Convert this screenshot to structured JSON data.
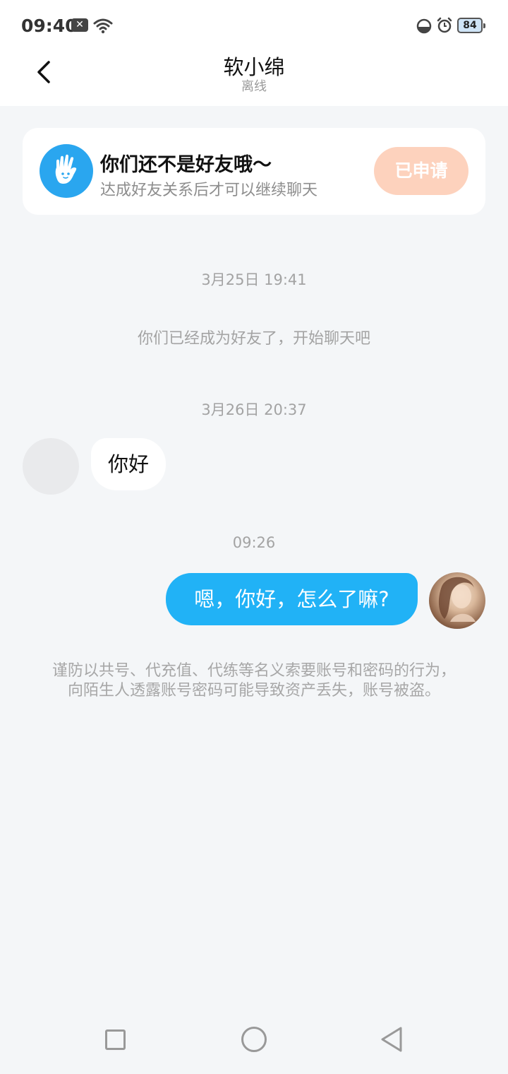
{
  "status_bar": {
    "time": "09:40",
    "notification_icon": "x-badge-icon",
    "battery": "84"
  },
  "header": {
    "title": "软小绵",
    "subtitle": "离线",
    "back_icon": "chevron-left-icon"
  },
  "friend_banner": {
    "title": "你们还不是好友哦～",
    "description": "达成好友关系后才可以继续聊天",
    "button_label": "已申请",
    "icon": "waving-hand-icon",
    "accent_color": "#2aa6ef",
    "button_color": "#fdd2bd"
  },
  "chat": {
    "timestamp_1": "3月25日 19:41",
    "system_message": "你们已经成为好友了，开始聊天吧",
    "timestamp_2": "3月26日 20:37",
    "incoming_message": "你好",
    "timestamp_3": "09:26",
    "outgoing_message": "嗯，你好，怎么了嘛?",
    "outgoing_color": "#21b2f6"
  },
  "warning": "谨防以共号、代充值、代练等名义索要账号和密码的行为，向陌生人透露账号密码可能导致资产丢失，账号被盗。",
  "nav_bar": {
    "recent_icon": "square-icon",
    "home_icon": "circle-icon",
    "back_icon": "triangle-back-icon"
  }
}
